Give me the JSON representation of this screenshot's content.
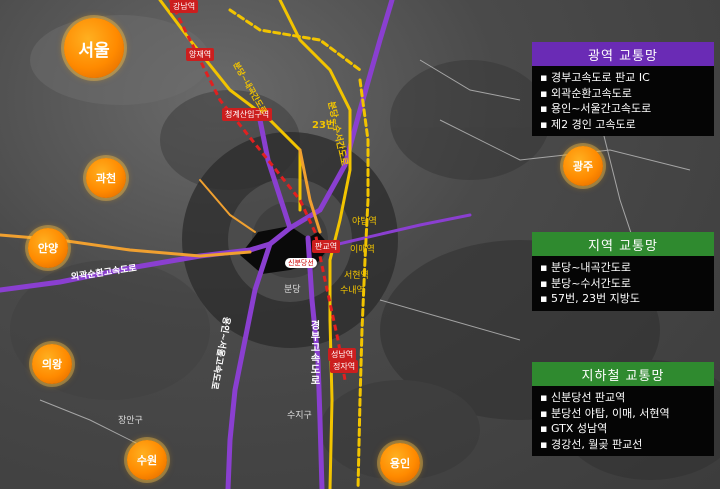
{
  "cities": {
    "seoul": "서울",
    "gwacheon": "과천",
    "anyang": "안양",
    "uiwang": "의왕",
    "suwon": "수원",
    "gwangju": "광주",
    "yongin": "용인"
  },
  "stations": {
    "yangjae": "양재역",
    "cheonggye": "청계산입구역",
    "pangyo": "판교역",
    "jeongja": "정자역",
    "seongnam": "성남역",
    "gangnam": "강남역"
  },
  "map_labels": {
    "yatap": "야탑역",
    "imae": "이매역",
    "seohyeon": "서현역",
    "sunae": "수내역",
    "bundang": "분당",
    "suji": "수지구",
    "jangan": "장안구",
    "anyang_gu": "안양",
    "sinbundang": "신분당선",
    "road23": "23번",
    "road_bundang": "분당~수서간도로",
    "road_gyeongbu": "경부고속도로",
    "road_outer": "외곽순환고속도로",
    "road_yongin": "용인~서울고속도로",
    "road_bundang_naegok": "분당~내곡간도로"
  },
  "panels": {
    "wide": {
      "title": "광역 교통망",
      "items": [
        "경부고속도로 판교 IC",
        "외곽순환고속도로",
        "용인~서울간고속도로",
        "제2 경인 고속도로"
      ]
    },
    "regional": {
      "title": "지역 교통망",
      "items": [
        "분당~내곡간도로",
        "분당~수서간도로",
        "57번, 23번 지방도"
      ]
    },
    "subway": {
      "title": "지하철 교통망",
      "items": [
        "신분당선 판교역",
        "분당선 야탑, 이매, 서현역",
        "GTX 성남역",
        "경강선, 월곶 판교선"
      ]
    }
  },
  "colors": {
    "purple_road": "#8a3fd0",
    "yellow_road": "#f2c400",
    "orange_road": "#f0a030",
    "red_line": "#e02020",
    "wide_header": "#6a2bb5",
    "regional_header": "#2f8a2f",
    "subway_header": "#2f8a2f",
    "city_orange": "#ff8a00"
  }
}
